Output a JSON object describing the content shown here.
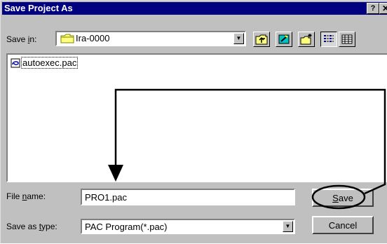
{
  "window": {
    "title": "Save Project As",
    "help_glyph": "?",
    "close_glyph": "✕"
  },
  "save_in": {
    "label_pre": "Save ",
    "label_key": "i",
    "label_post": "n:",
    "folder": "Ira-0000",
    "folder_icon": "folder-icon"
  },
  "toolbar": {
    "icons": [
      "up-one-level-icon",
      "desktop-icon",
      "new-folder-icon",
      "list-view-icon",
      "details-view-icon"
    ],
    "pressed": "list-view-icon"
  },
  "files": [
    {
      "name": "autoexec.pac",
      "icon": "document-icon"
    }
  ],
  "file_name": {
    "label_pre": "File ",
    "label_key": "n",
    "label_post": "ame:",
    "value": "PRO1.pac"
  },
  "save_type": {
    "label_pre": "Save as ",
    "label_key": "t",
    "label_post": "ype:",
    "value": "PAC Program(*.pac)"
  },
  "buttons": {
    "save_key": "S",
    "save_rest": "ave",
    "cancel": "Cancel"
  },
  "colors": {
    "titlebar": "#000080",
    "face": "#c0c0c0",
    "annotation": "#000000"
  }
}
